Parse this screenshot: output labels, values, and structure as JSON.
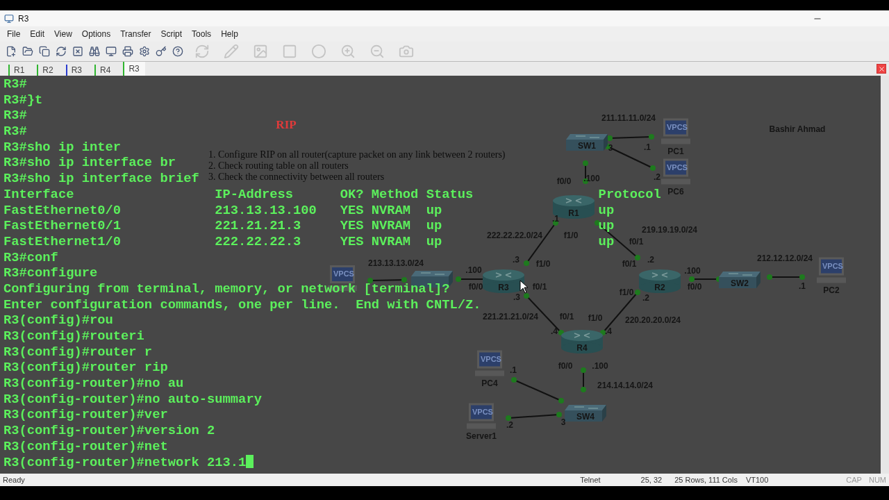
{
  "window": {
    "title": "R3"
  },
  "menu": [
    "File",
    "Edit",
    "View",
    "Options",
    "Transfer",
    "Script",
    "Tools",
    "Help"
  ],
  "tabs": [
    {
      "label": "R1",
      "color": "#2fb52f",
      "selected": false
    },
    {
      "label": "R2",
      "color": "#2fb52f",
      "selected": false
    },
    {
      "label": "R3",
      "color": "#2a3ccf",
      "selected": false
    },
    {
      "label": "R4",
      "color": "#2fb52f",
      "selected": false
    },
    {
      "label": "R3",
      "color": "#2fb52f",
      "selected": true
    }
  ],
  "terminal": {
    "lines": [
      "R3#",
      "R3#}t",
      "R3#",
      "R3#",
      "R3#sho ip inter",
      "R3#sho ip interface br",
      "R3#sho ip interface brief",
      "Interface                  IP-Address      OK? Method Status                Protocol",
      "FastEthernet0/0            213.13.13.100   YES NVRAM  up                    up",
      "FastEthernet0/1            221.21.21.3     YES NVRAM  up                    up",
      "FastEthernet1/0            222.22.22.3     YES NVRAM  up                    up",
      "R3#conf",
      "R3#configure",
      "Configuring from terminal, memory, or network [terminal]?",
      "Enter configuration commands, one per line.  End with CNTL/Z.",
      "R3(config)#rou",
      "R3(config)#routeri",
      "R3(config)#router r",
      "R3(config)#router rip",
      "R3(config-router)#no au",
      "R3(config-router)#no auto-summary",
      "R3(config-router)#ver",
      "R3(config-router)#version 2",
      "R3(config-router)#net",
      "R3(config-router)#network 213.1"
    ]
  },
  "topology": {
    "title": "RIP",
    "author": "Bashir Ahmad",
    "tasks": [
      "1. Configure RIP on all router(capture packet on any link between 2 routers)",
      "2. Check routing table on all routers",
      "3. Check the connectivity between all routers"
    ],
    "nodes": [
      {
        "kind": "switch",
        "label": "SW1"
      },
      {
        "kind": "pc",
        "label": "PC1",
        "screen_text": "VPCS"
      },
      {
        "kind": "pc",
        "label": "PC6",
        "screen_text": "VPCS"
      },
      {
        "kind": "router",
        "label": "R1"
      },
      {
        "kind": "router",
        "label": "R3"
      },
      {
        "kind": "router",
        "label": "R2"
      },
      {
        "kind": "switch",
        "label": "SW2"
      },
      {
        "kind": "pc",
        "label": "PC2",
        "screen_text": "VPCS"
      },
      {
        "kind": "router",
        "label": "R4"
      },
      {
        "kind": "pc",
        "label": "PC4",
        "screen_text": "VPCS"
      },
      {
        "kind": "pc",
        "label": "Server1",
        "screen_text": "VPCS"
      },
      {
        "kind": "switch",
        "label": "SW4"
      },
      {
        "kind": "pc",
        "screen_text": "VPCS"
      },
      {
        "kind": "switch"
      }
    ],
    "annotations": [
      "211.11.11.0/24",
      "3",
      ".1",
      ".2",
      "f0/0",
      ".100",
      ".1",
      "222.22.22.0/24",
      "f1/0",
      "f0/1",
      "219.19.19.0/24",
      "213.13.13.0/24",
      ".3",
      "f1/0",
      "f0/1",
      ".2",
      "212.12.12.0/24",
      ".100",
      ".100",
      "f0/0",
      "f0/1",
      "f0/0",
      ".1",
      "f1/0",
      ".3",
      ".2",
      "221.21.21.0/24",
      "f0/1",
      "f1/0",
      "220.20.20.0/24",
      ".4",
      ".4",
      "f0/0",
      ".100",
      ".1",
      "214.14.14.0/24",
      "3",
      ".2"
    ]
  },
  "status_bar": {
    "message": "Ready",
    "protocol": "Telnet",
    "position": "25, 32",
    "size": "25 Rows, 111 Cols",
    "emulation": "VT100",
    "indicators": [
      "CAP",
      "NUM"
    ]
  }
}
